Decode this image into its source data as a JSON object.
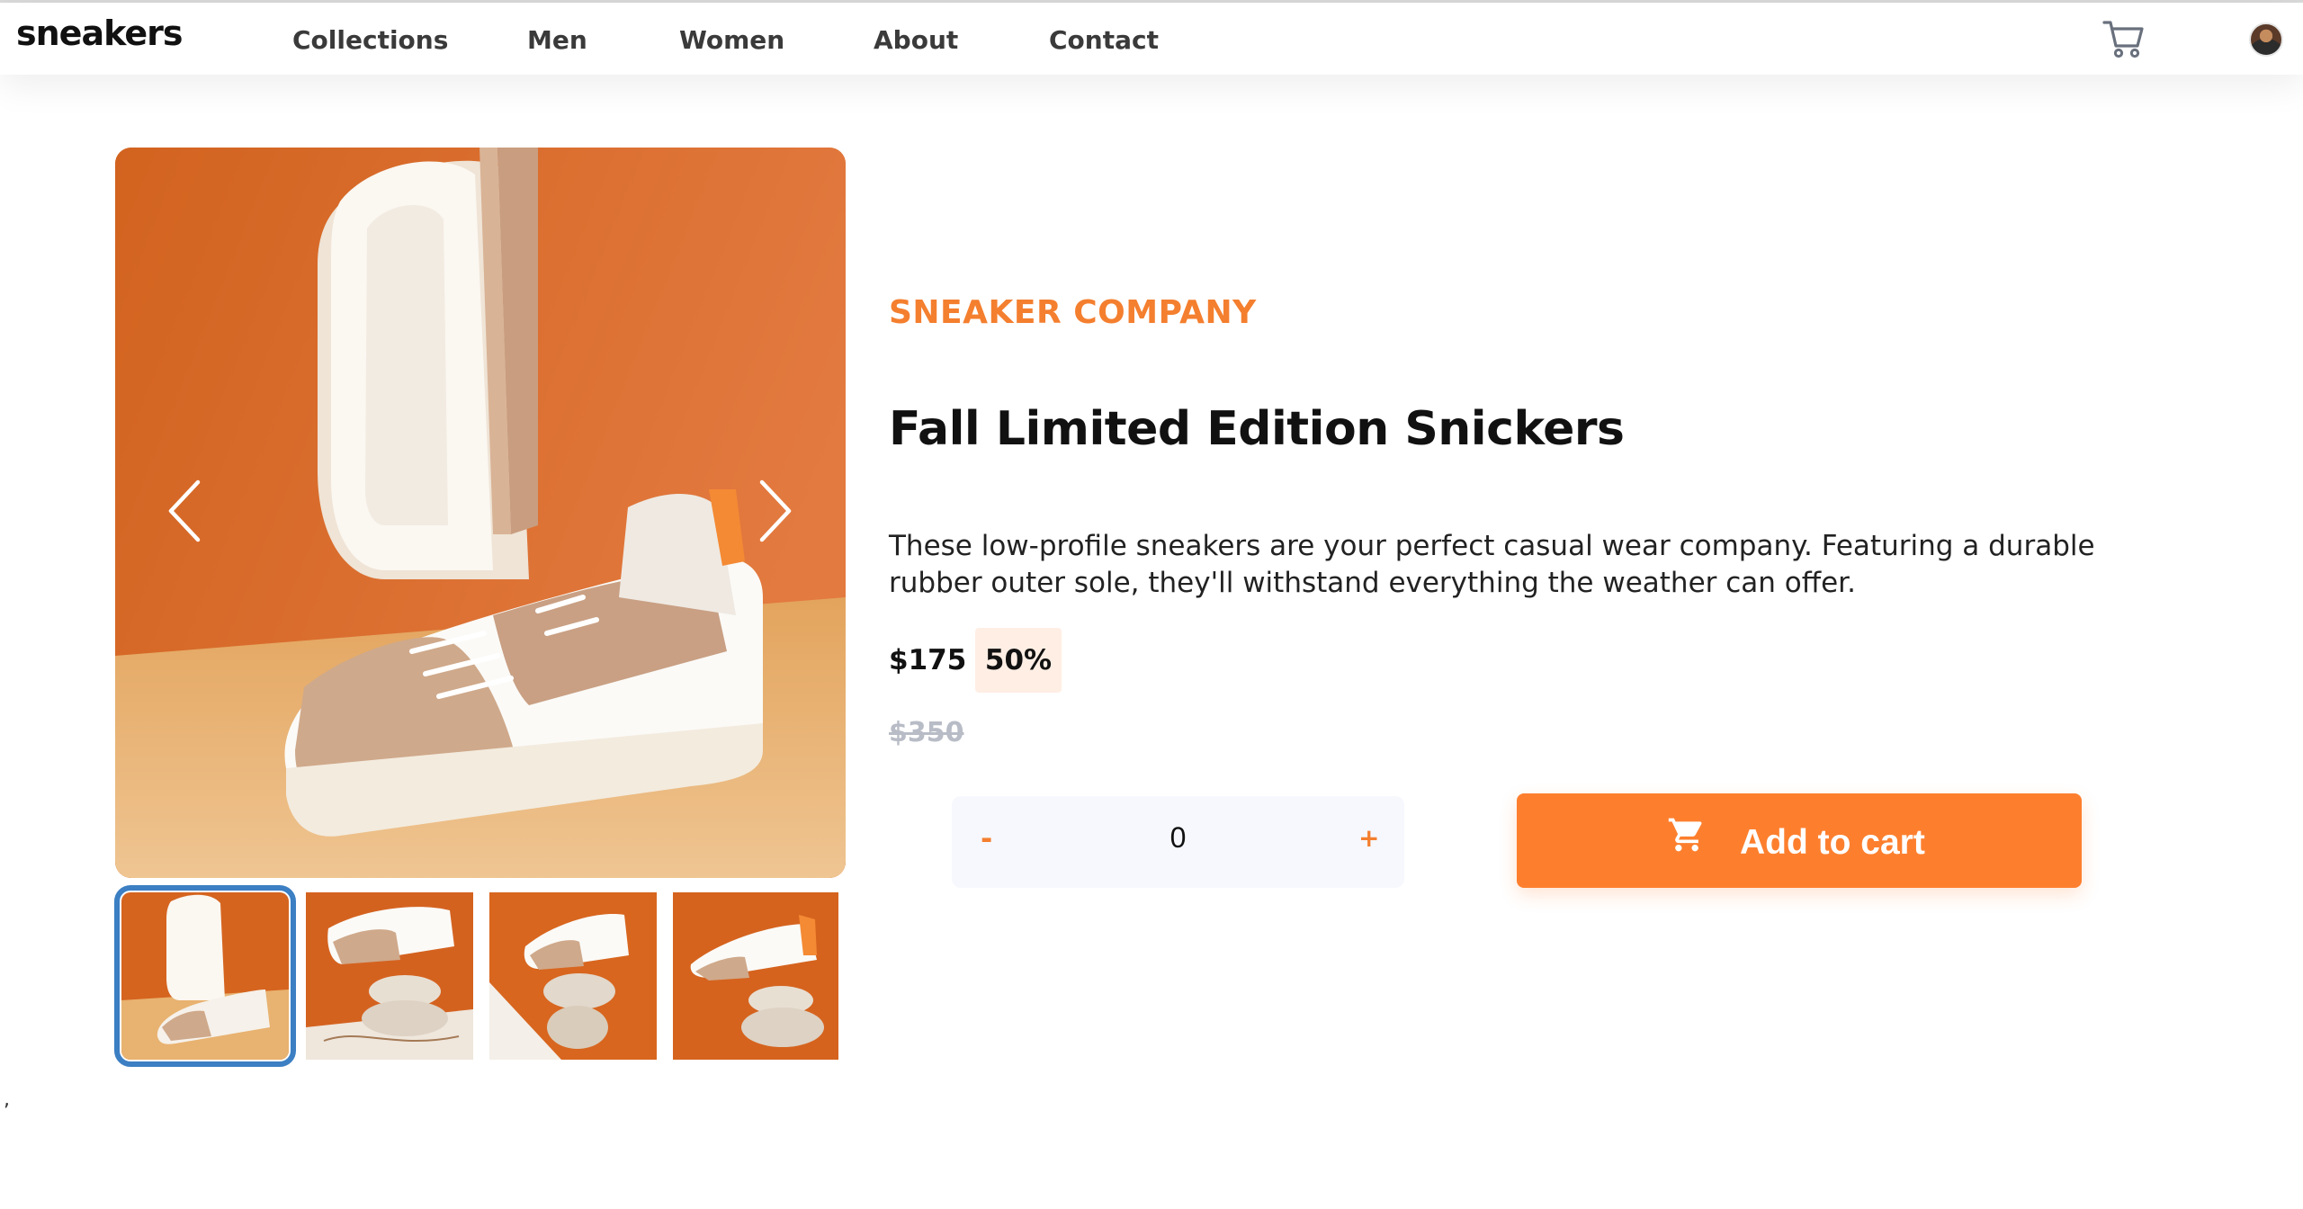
{
  "header": {
    "logo": "sneakers",
    "nav": [
      "Collections",
      "Men",
      "Women",
      "About",
      "Contact"
    ],
    "cart_icon": "cart-icon",
    "avatar_icon": "user-avatar"
  },
  "gallery": {
    "prev_icon": "chevron-left-icon",
    "next_icon": "chevron-right-icon",
    "thumbnail_count": 4,
    "active_thumbnail": 1
  },
  "product": {
    "company": "SNEAKER COMPANY",
    "title": "Fall Limited Edition Snickers",
    "description": "These low-profile sneakers are your perfect casual wear company. Featuring a durable rubber outer sole, they'll withstand everything the weather can offer.",
    "price": "$175",
    "discount": "50%",
    "original_price": "$350"
  },
  "quantity": {
    "minus_label": "-",
    "value": "0",
    "plus_label": "+"
  },
  "add_to_cart": {
    "label": "Add to cart",
    "icon": "cart-icon"
  },
  "footer_stray": ",",
  "colors": {
    "accent": "#fd7f2e",
    "accent_text": "#f47f2f",
    "discount_bg": "#ffeee4",
    "qty_bg": "#f6f8fd",
    "active_thumb_border": "#3c7fc3",
    "muted": "#b8bcc6"
  }
}
